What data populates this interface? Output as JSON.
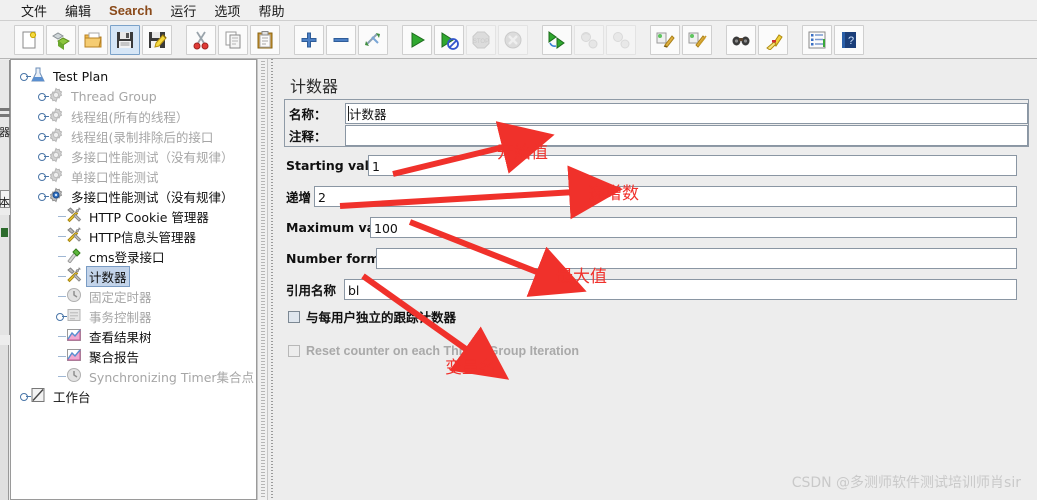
{
  "menubar": {
    "items": [
      {
        "label": "文件",
        "accent": false
      },
      {
        "label": "编辑",
        "accent": false
      },
      {
        "label": "Search",
        "accent": true
      },
      {
        "label": "运行",
        "accent": false
      },
      {
        "label": "选项",
        "accent": false
      },
      {
        "label": "帮助",
        "accent": false
      }
    ]
  },
  "toolbar": {
    "buttons": [
      {
        "name": "new-icon",
        "group": 0,
        "state": "normal"
      },
      {
        "name": "templates-icon",
        "group": 0,
        "state": "normal"
      },
      {
        "name": "open-icon",
        "group": 0,
        "state": "normal"
      },
      {
        "name": "save-icon",
        "group": 0,
        "state": "active"
      },
      {
        "name": "save-as-icon",
        "group": 0,
        "state": "normal"
      },
      {
        "name": "cut-icon",
        "group": 1,
        "state": "normal"
      },
      {
        "name": "copy-icon",
        "group": 1,
        "state": "normal"
      },
      {
        "name": "paste-icon",
        "group": 1,
        "state": "normal"
      },
      {
        "name": "expand-all-icon",
        "group": 2,
        "state": "normal"
      },
      {
        "name": "collapse-all-icon",
        "group": 2,
        "state": "normal"
      },
      {
        "name": "toggle-icon",
        "group": 2,
        "state": "normal"
      },
      {
        "name": "start-icon",
        "group": 3,
        "state": "normal"
      },
      {
        "name": "start-no-pauses-icon",
        "group": 3,
        "state": "normal"
      },
      {
        "name": "stop-icon",
        "group": 3,
        "state": "disabled"
      },
      {
        "name": "shutdown-icon",
        "group": 3,
        "state": "disabled"
      },
      {
        "name": "remote-start-all-icon",
        "group": 4,
        "state": "normal"
      },
      {
        "name": "remote-stop-all-icon",
        "group": 4,
        "state": "disabled"
      },
      {
        "name": "remote-shutdown-all-icon",
        "group": 4,
        "state": "disabled"
      },
      {
        "name": "clear-icon",
        "group": 5,
        "state": "normal"
      },
      {
        "name": "clear-all-icon",
        "group": 5,
        "state": "normal"
      },
      {
        "name": "search-icon",
        "group": 6,
        "state": "normal"
      },
      {
        "name": "search-reset-icon",
        "group": 6,
        "state": "normal"
      },
      {
        "name": "function-helper-icon",
        "group": 7,
        "state": "normal"
      },
      {
        "name": "help-icon",
        "group": 7,
        "state": "normal"
      }
    ]
  },
  "tree": {
    "nodes": [
      {
        "label": "Test Plan",
        "depth": 0,
        "icon": "test-plan-icon",
        "dim": false,
        "selected": false,
        "expander": true
      },
      {
        "label": "Thread Group",
        "depth": 1,
        "icon": "thread-group-icon",
        "dim": true,
        "selected": false,
        "expander": true
      },
      {
        "label": "线程组(所有的线程）",
        "depth": 1,
        "icon": "thread-group-icon",
        "dim": true,
        "selected": false,
        "expander": true
      },
      {
        "label": "线程组(录制排除后的接口",
        "depth": 1,
        "icon": "thread-group-icon",
        "dim": true,
        "selected": false,
        "expander": true
      },
      {
        "label": "多接口性能测试（没有规律）",
        "depth": 1,
        "icon": "thread-group-icon",
        "dim": true,
        "selected": false,
        "expander": true
      },
      {
        "label": "单接口性能测试",
        "depth": 1,
        "icon": "thread-group-icon",
        "dim": true,
        "selected": false,
        "expander": true
      },
      {
        "label": "多接口性能测试（没有规律）",
        "depth": 1,
        "icon": "thread-group-active-icon",
        "dim": false,
        "selected": false,
        "expander": true
      },
      {
        "label": "HTTP Cookie 管理器",
        "depth": 2,
        "icon": "config-element-icon",
        "dim": false,
        "selected": false,
        "expander": false
      },
      {
        "label": "HTTP信息头管理器",
        "depth": 2,
        "icon": "config-element-icon",
        "dim": false,
        "selected": false,
        "expander": false
      },
      {
        "label": "cms登录接口",
        "depth": 2,
        "icon": "sampler-icon",
        "dim": false,
        "selected": false,
        "expander": false
      },
      {
        "label": "计数器",
        "depth": 2,
        "icon": "config-element-icon",
        "dim": false,
        "selected": true,
        "expander": false
      },
      {
        "label": "固定定时器",
        "depth": 2,
        "icon": "timer-icon",
        "dim": true,
        "selected": false,
        "expander": false
      },
      {
        "label": "事务控制器",
        "depth": 2,
        "icon": "controller-icon",
        "dim": true,
        "selected": false,
        "expander": true
      },
      {
        "label": "查看结果树",
        "depth": 2,
        "icon": "listener-icon",
        "dim": false,
        "selected": false,
        "expander": false
      },
      {
        "label": "聚合报告",
        "depth": 2,
        "icon": "listener-icon",
        "dim": false,
        "selected": false,
        "expander": false
      },
      {
        "label": "Synchronizing Timer集合点",
        "depth": 2,
        "icon": "timer-icon",
        "dim": true,
        "selected": false,
        "expander": false
      },
      {
        "label": "工作台",
        "depth": 0,
        "icon": "workbench-icon",
        "dim": false,
        "selected": false,
        "expander": true
      }
    ]
  },
  "panel": {
    "title": "计数器",
    "name_label": "名称：",
    "name_value": "计数器",
    "comment_label": "注释：",
    "comment_value": "",
    "fields": [
      {
        "label": "Starting value",
        "value": "1",
        "name": "starting-value"
      },
      {
        "label": "递增",
        "value": "2",
        "name": "increment-value"
      },
      {
        "label": "Maximum value",
        "value": "100",
        "name": "maximum-value"
      },
      {
        "label": "Number format",
        "value": "",
        "name": "number-format"
      },
      {
        "label": "引用名称",
        "value": "bl",
        "name": "reference-name"
      }
    ],
    "checkboxes": [
      {
        "label": "与每用户独立的跟踪计数器",
        "checked": false,
        "disabled": false,
        "name": "per-user-checkbox"
      },
      {
        "label": "Reset counter on each Thread Group Iteration",
        "checked": false,
        "disabled": true,
        "name": "reset-counter-checkbox"
      }
    ]
  },
  "annotations": {
    "arrow_color": "#f0312b",
    "labels": [
      {
        "text": "开始值",
        "name": "annotation-starting-value"
      },
      {
        "text": "递增数",
        "name": "annotation-increment"
      },
      {
        "text": "最大值",
        "name": "annotation-maximum"
      },
      {
        "text": "变量名",
        "name": "annotation-variable-name"
      }
    ]
  },
  "watermark": {
    "text": "CSDN @多测师软件测试培训师肖sir"
  }
}
